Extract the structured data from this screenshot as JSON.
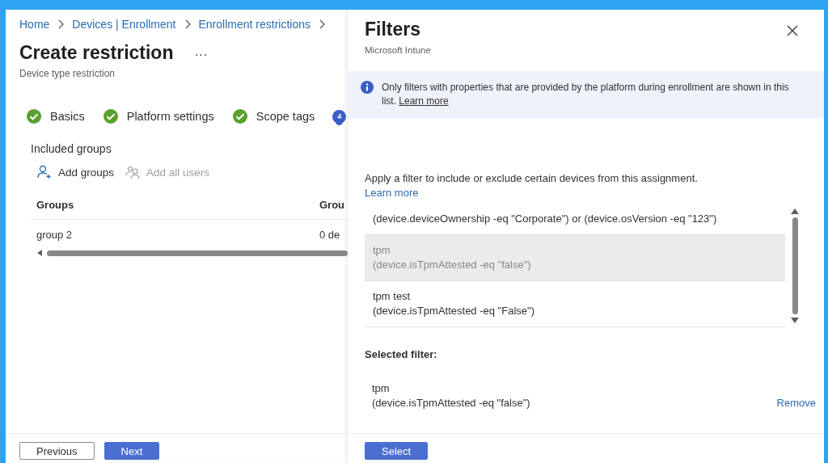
{
  "breadcrumb": [
    {
      "label": "Home"
    },
    {
      "label": "Devices | Enrollment"
    },
    {
      "label": "Enrollment restrictions"
    }
  ],
  "page": {
    "title": "Create restriction",
    "more": "···",
    "subtitle": "Device type restriction"
  },
  "steps": [
    {
      "label": "Basics",
      "completed": true
    },
    {
      "label": "Platform settings",
      "completed": true
    },
    {
      "label": "Scope tags",
      "completed": true
    },
    {
      "number": "4",
      "completed": false
    }
  ],
  "section_title": "Included groups",
  "toolbar": [
    {
      "label": "Add groups",
      "kind": "add-groups",
      "disabled": false
    },
    {
      "label": "Add all users",
      "kind": "add-all-users",
      "disabled": true
    }
  ],
  "table": {
    "columns": [
      "Groups",
      "Grou"
    ],
    "rows": [
      [
        "group 2",
        "0 de"
      ]
    ]
  },
  "footer_buttons": [
    {
      "label": "Previous",
      "kind": "secondary"
    },
    {
      "label": "Next",
      "kind": "primary"
    }
  ],
  "filters_panel": {
    "title": "Filters",
    "subtitle": "Microsoft Intune",
    "info": {
      "text": "Only filters with properties that are provided by the platform during enrollment are shown in this list.",
      "link": "Learn more"
    },
    "description": "Apply a filter to include or exclude certain devices from this assignment.",
    "description_link": "Learn more",
    "filters": [
      {
        "expression": "(device.deviceOwnership -eq \"Corporate\") or (device.osVersion -eq \"123\")",
        "selected": false
      },
      {
        "name": "tpm",
        "expression": "(device.isTpmAttested -eq \"false\")",
        "selected": true
      },
      {
        "name": "tpm test",
        "expression": "(device.isTpmAttested -eq \"False\")",
        "selected": false
      }
    ],
    "selected_heading": "Selected filter:",
    "selected_filter": {
      "name": "tpm",
      "expression": "(device.isTpmAttested -eq \"false\")"
    },
    "remove": "Remove",
    "select_button": "Select"
  }
}
